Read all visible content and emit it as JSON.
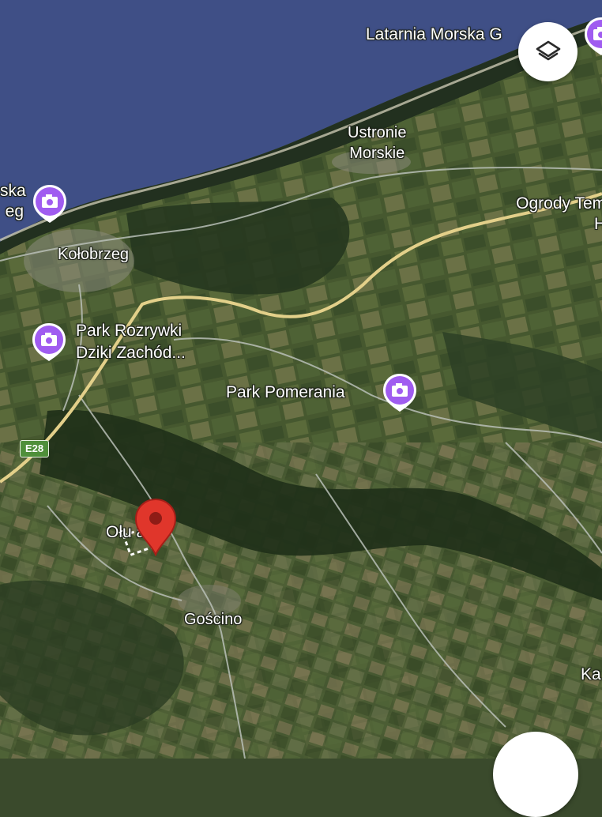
{
  "map": {
    "colors": {
      "sea": "#3f4f86",
      "land": "#3f5230",
      "beach": "#c9c7b0",
      "road_major": "#e3d08a",
      "road_minor": "#b9bfb7",
      "poi": "#a05cf0",
      "pin": "#e0362b"
    }
  },
  "labels": {
    "lighthouse": "Latarnia Morska G",
    "ustronie_1": "Ustronie",
    "ustronie_2": "Morskie",
    "ogrody_1": "Ogrody Tem",
    "ogrody_2": "H",
    "left_poi_1": "ska",
    "left_poi_2": "eg",
    "kolobrzeg": "Kołobrzeg",
    "park_rozrywki_1": "Park Rozrywki",
    "park_rozrywki_2": "Dziki Zachód...",
    "park_pomerania": "Park Pomerania",
    "oluchna": "Ołu a",
    "goscino": "Gościno",
    "ka": "Ka",
    "route": "E28"
  },
  "controls": {
    "layers_icon": "layers-icon",
    "poi_icon": "photo-camera-icon",
    "pin_icon": "map-pin-icon"
  }
}
